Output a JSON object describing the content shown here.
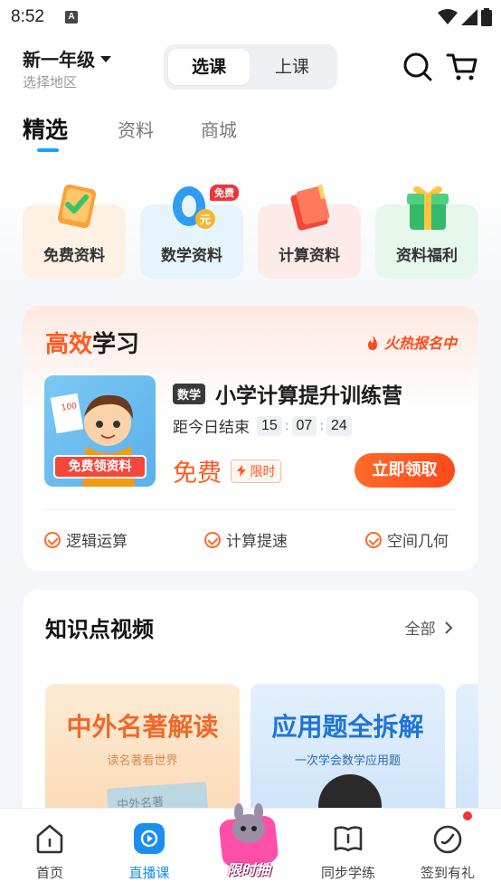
{
  "status_bar": {
    "time": "8:52",
    "notif_glyph": "A"
  },
  "header": {
    "grade": "新一年级",
    "region_placeholder": "选择地区",
    "segment": {
      "active": "选课",
      "inactive": "上课"
    }
  },
  "tabs": [
    "精选",
    "资料",
    "商城"
  ],
  "quick_entries": [
    {
      "label": "免费资料",
      "icon": "clipboard-check-icon"
    },
    {
      "label": "数学资料",
      "icon": "zero-coin-icon",
      "tag": "免费",
      "coin": "元"
    },
    {
      "label": "计算资料",
      "icon": "book-icon"
    },
    {
      "label": "资料福利",
      "icon": "gift-icon"
    }
  ],
  "promo": {
    "title_highlight": "高效",
    "title_rest": "学习",
    "hot": "火热报名中",
    "image_label": "免费领资料",
    "image_paper": "100",
    "subject": "数学",
    "course_title": "小学计算提升训练营",
    "countdown_label": "距今日结束",
    "countdown": [
      "15",
      "07",
      "24"
    ],
    "countdown_sep": ":",
    "price": "免费",
    "limit_tag": "限时",
    "claim_button": "立即领取",
    "features": [
      "逻辑运算",
      "计算提速",
      "空间几何"
    ]
  },
  "knowledge_videos": {
    "title": "知识点视频",
    "all_label": "全部",
    "cards": [
      {
        "title": "中外名著解读",
        "subtitle": "读名著看世界",
        "book": "中外名著"
      },
      {
        "title": "应用题全拆解",
        "subtitle": "一次学会数学应用题"
      }
    ]
  },
  "bottom_nav": {
    "items": [
      {
        "label": "首页",
        "icon": "home-icon"
      },
      {
        "label": "直播课",
        "icon": "live-play-icon",
        "active": true
      },
      {
        "label": "限时抽",
        "icon": "mascot-lottery-icon"
      },
      {
        "label": "同步学练",
        "icon": "open-book-icon"
      },
      {
        "label": "签到有礼",
        "icon": "checkin-icon"
      }
    ]
  },
  "colors": {
    "accent_blue": "#19a2f5",
    "accent_orange": "#ff5a1f",
    "hot_red": "#f23535"
  }
}
